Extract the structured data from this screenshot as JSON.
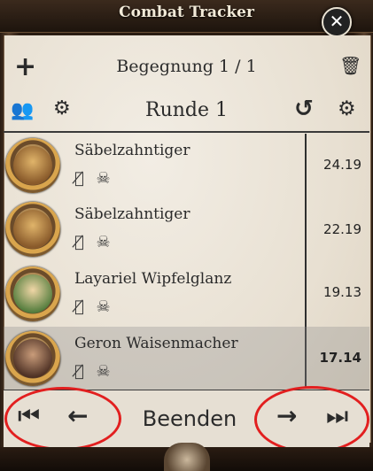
{
  "window": {
    "title": "Combat Tracker",
    "close_symbol": "✕"
  },
  "header": {
    "encounter": "Begegnung 1 / 1",
    "round": "Runde 1",
    "add_symbol": "+",
    "delete_symbol": "🗑",
    "players_symbol": "👥",
    "config_group_symbol": "⚙",
    "reset_symbol": "↺",
    "settings_symbol": "⚙"
  },
  "combatants": [
    {
      "name": "Säbelzahntiger",
      "initiative": "24.19",
      "status": "👁̸ ☠"
    },
    {
      "name": "Säbelzahntiger",
      "initiative": "22.19",
      "status": "👁̸ ☠"
    },
    {
      "name": "Layariel Wipfelglanz",
      "initiative": "19.13",
      "status": "👁̸ ☠"
    },
    {
      "name": "Geron Waisenmacher",
      "initiative": "17.14",
      "status": "👁̸ ☠"
    }
  ],
  "footer": {
    "first_symbol": "⏮",
    "prev_symbol": "←",
    "end_label": "Beenden",
    "next_symbol": "→",
    "last_symbol": "⏭"
  },
  "colors": {
    "highlight": "#e21f1f",
    "parchment": "#ebe4d8",
    "frame": "#2a1c12"
  }
}
